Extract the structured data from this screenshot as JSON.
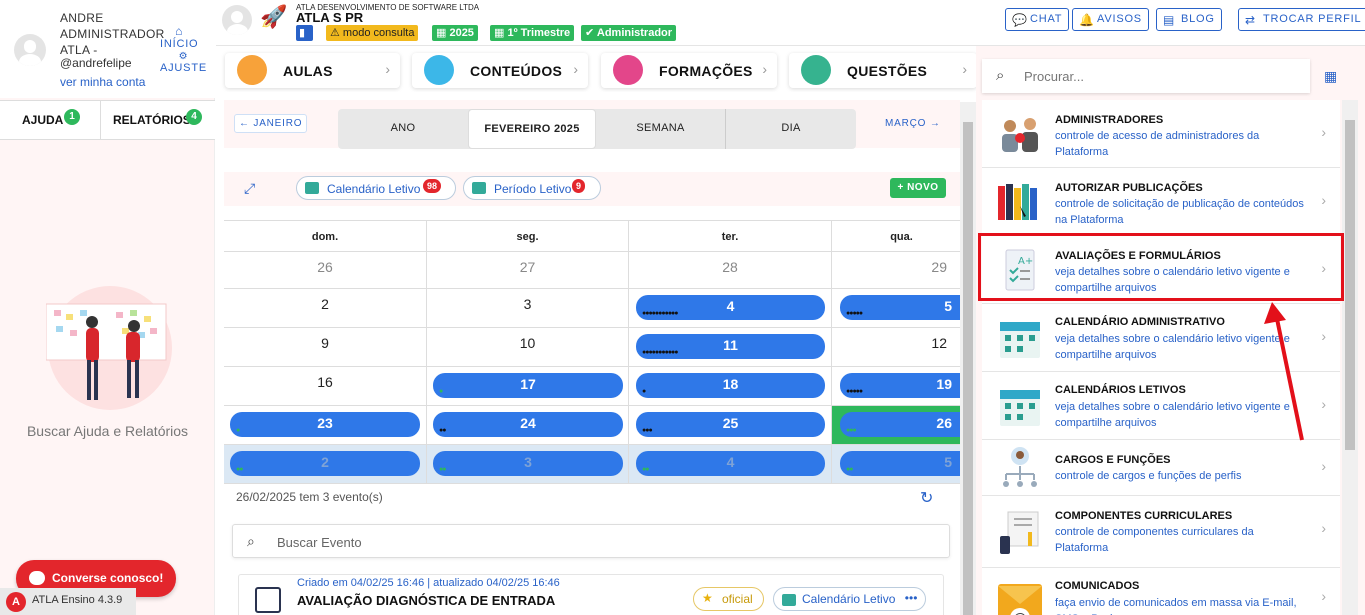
{
  "user": {
    "name": "ANDRE ADMINISTRADOR ATLA -",
    "handle": "@andrefelipe",
    "account_link": "ver minha conta"
  },
  "side_links": {
    "home": "INÍCIO",
    "settings": "AJUSTE"
  },
  "left_tabs": [
    {
      "label": "AJUDA",
      "count": "1"
    },
    {
      "label": "RELATÓRIOS",
      "count": "4"
    }
  ],
  "help_title": "Buscar Ajuda e Relatórios",
  "chat_button": "Converse conosco!",
  "version": "ATLA Ensino 4.3.9",
  "org": {
    "small": "ATLA DESENVOLVIMENTO DE SOFTWARE LTDA",
    "name": "ATLA S PR"
  },
  "chips": {
    "mode": "modo consulta",
    "year": "2025",
    "period": "1º Trimestre",
    "role": "Administrador"
  },
  "header_buttons": {
    "chat": "CHAT",
    "notices": "AVISOS",
    "blog": "BLOG",
    "switch_profile": "TROCAR PERFIL"
  },
  "modules": [
    {
      "label": "AULAS"
    },
    {
      "label": "CONTEÚDOS"
    },
    {
      "label": "FORMAÇÕES"
    },
    {
      "label": "QUESTÕES"
    }
  ],
  "calendar": {
    "prev": "JANEIRO",
    "next": "MARÇO",
    "views": [
      "ANO",
      "FEVEREIRO 2025",
      "SEMANA",
      "DIA"
    ],
    "pills": [
      {
        "label": "Calendário Letivo",
        "count": "98"
      },
      {
        "label": "Período Letivo",
        "count": "9"
      }
    ],
    "new_button": "NOVO",
    "weekdays": [
      "dom.",
      "seg.",
      "ter.",
      "qua."
    ],
    "rows": [
      [
        "26",
        "27",
        "28",
        "29"
      ],
      [
        "2",
        "3",
        "4",
        "5"
      ],
      [
        "9",
        "10",
        "11",
        "12"
      ],
      [
        "16",
        "17",
        "18",
        "19"
      ],
      [
        "23",
        "24",
        "25",
        "26"
      ],
      [
        "2",
        "3",
        "4",
        "5"
      ]
    ],
    "summary": "26/02/2025 tem 3 evento(s)",
    "search_placeholder": "Buscar Evento"
  },
  "event_card": {
    "meta": "Criado em 04/02/25 16:46 | atualizado 04/02/25 16:46",
    "title": "AVALIAÇÃO DIAGNÓSTICA DE ENTRADA",
    "tag_official": "oficial",
    "tag_calendar": "Calendário Letivo"
  },
  "right": {
    "search_placeholder": "Procurar...",
    "items": [
      {
        "title": "ADMINISTRADORES",
        "desc": "controle de acesso de administradores da Plataforma"
      },
      {
        "title": "AUTORIZAR PUBLICAÇÕES",
        "desc": "controle de solicitação de publicação de conteúdos na Plataforma"
      },
      {
        "title": "AVALIAÇÕES E FORMULÁRIOS",
        "desc": "veja detalhes sobre o calendário letivo vigente e compartilhe arquivos"
      },
      {
        "title": "CALENDÁRIO ADMINISTRATIVO",
        "desc": "veja detalhes sobre o calendário letivo vigente e compartilhe arquivos"
      },
      {
        "title": "CALENDÁRIOS LETIVOS",
        "desc": "veja detalhes sobre o calendário letivo vigente e compartilhe arquivos"
      },
      {
        "title": "CARGOS E FUNÇÕES",
        "desc": "controle de cargos e funções de perfis"
      },
      {
        "title": "COMPONENTES CURRICULARES",
        "desc": "controle de componentes curriculares da Plataforma"
      },
      {
        "title": "COMUNICADOS",
        "desc": "faça envio de comunicados em massa via E-mail, SMS e Push"
      }
    ]
  },
  "colors": {
    "accent": "#2962c8",
    "event": "#2f78e8",
    "green": "#2eb85c",
    "red": "#e3262c"
  }
}
